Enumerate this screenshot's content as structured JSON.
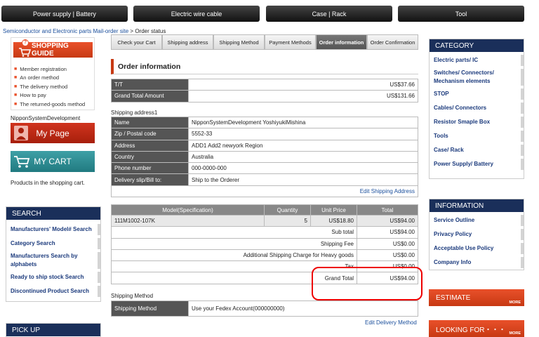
{
  "topnav": [
    "Power supply | Battery",
    "Electric wire cable",
    "Case | Rack",
    "Tool"
  ],
  "breadcrumb": {
    "home": "Semiconductor and Electronic parts Mail-order site",
    "sep": ">",
    "current": "Order status"
  },
  "guide": {
    "title": "SHOPPING GUIDE",
    "items": [
      "Member registration",
      "An order method",
      "The delivery method",
      "How to pay",
      "The returned-goods method"
    ]
  },
  "user": {
    "name": "NipponSystemDevelopment",
    "mypage": "My Page",
    "mycart": "MY CART",
    "cart_note": "Products in the shopping cart."
  },
  "search": {
    "title": "SEARCH",
    "items": [
      "Manufacturers' Model# Search",
      "Category Search",
      "Manufacturers Search by alphabets",
      "Ready to ship stock Search",
      "Discontinued Product Search"
    ]
  },
  "pickup": {
    "title": "PICK UP"
  },
  "steps": [
    "Check your Cart",
    "Shipping address",
    "Shipping Method",
    "Payment Methods",
    "Order information",
    "Order Confirmation"
  ],
  "order": {
    "title": "Order information",
    "tt_label": "T/T",
    "tt_value": "US$37.66",
    "grand_label": "Grand Total Amount",
    "grand_value": "US$131.66"
  },
  "shipping": {
    "heading": "Shipping address1",
    "rows": [
      {
        "k": "Name",
        "v": "NipponSystemDevelopment  YoshiyukiMishina"
      },
      {
        "k": "Zip / Postal code",
        "v": "5552-33"
      },
      {
        "k": "Address",
        "v": "ADD1 Add2 newyork Region"
      },
      {
        "k": "Country",
        "v": "Australia"
      },
      {
        "k": "Phone number",
        "v": "000-0000-000"
      },
      {
        "k": "Delivery slip/Bill to:",
        "v": "Ship to the Orderer"
      }
    ],
    "edit": "Edit Shipping Address"
  },
  "items": {
    "headers": [
      "Model(Specification)",
      "Quantity",
      "Unit Price",
      "Total"
    ],
    "row": {
      "model": "111M1002-107K",
      "qty": "5",
      "price": "US$18.80",
      "total": "US$94.00"
    },
    "summary": [
      {
        "k": "Sub total",
        "v": "US$94.00"
      },
      {
        "k": "Shipping Fee",
        "v": "US$0.00"
      },
      {
        "k": "Additional Shipping Charge for Heavy goods",
        "v": "US$0.00"
      },
      {
        "k": "Tax",
        "v": "US$0.00"
      },
      {
        "k": "Grand Total",
        "v": "US$94.00"
      }
    ]
  },
  "method": {
    "heading": "Shipping Method",
    "k": "Shipping Method",
    "v": "Use your Fedex Account(000000000)",
    "edit": "Edit Delivery Method"
  },
  "category": {
    "title": "CATEGORY",
    "items": [
      "Electric parts/ IC",
      "Switches/ Connectors/ Mechanism elements",
      "STOP",
      "Cables/ Connectors",
      "Resistor Smaple Box",
      "Tools",
      "Case/ Rack",
      "Power Supply/ Battery"
    ]
  },
  "information": {
    "title": "INFORMATION",
    "items": [
      "Service Outline",
      "Privacy Policy",
      "Acceptable Use Policy",
      "Company Info"
    ]
  },
  "estimate": {
    "label": "ESTIMATE",
    "more": "MORE"
  },
  "looking": {
    "label": "LOOKING FOR・・・",
    "more": "MORE"
  },
  "colors": {
    "accent": "#c73913",
    "navy": "#1a2f5a",
    "highlight": "#e00000"
  }
}
